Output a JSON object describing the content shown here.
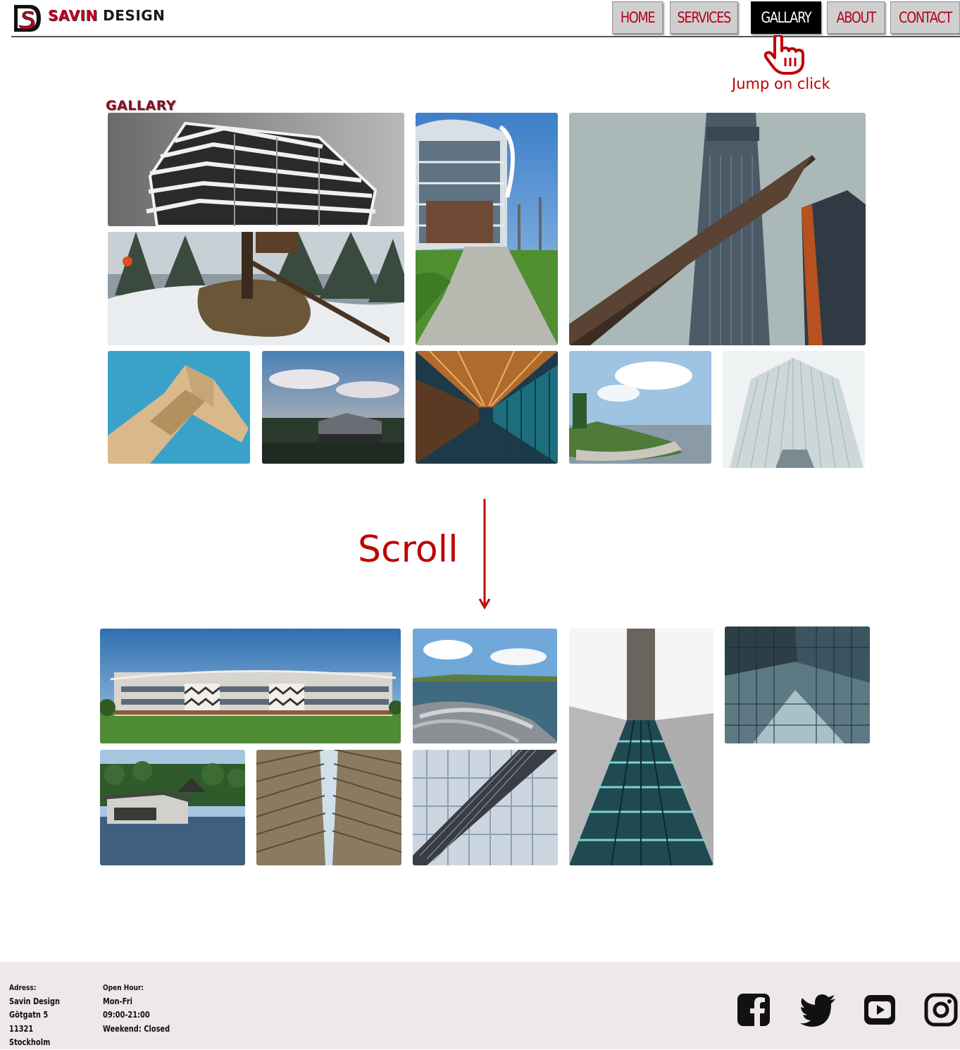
{
  "header": {
    "brand_part1": "SAVIN",
    "brand_part2": "DESIGN",
    "logo_letter": "S",
    "nav": [
      "HOME",
      "SERVICES",
      "GALLARY",
      "ABOUT",
      "CONTACT"
    ],
    "active_nav": "GALLARY"
  },
  "annotations": {
    "click_hint": "Jump on click",
    "scroll_hint": "Scroll"
  },
  "gallery": {
    "title": "GALLARY"
  },
  "footer": {
    "address": {
      "heading": "Adress:",
      "lines": [
        "Savin Design",
        "Götgatn 5",
        "11321",
        "Stockholm"
      ]
    },
    "hours": {
      "heading": "Open Hour:",
      "lines": [
        "Mon-Fri",
        "09:00-21:00",
        "Weekend: Closed"
      ]
    },
    "social_icons": [
      "facebook-icon",
      "twitter-icon",
      "youtube-icon",
      "instagram-icon"
    ]
  },
  "colors": {
    "brand_red": "#c50020",
    "nav_text": "#b3001b",
    "annotation_red": "#c00000",
    "footer_bg": "#eee8e8"
  }
}
